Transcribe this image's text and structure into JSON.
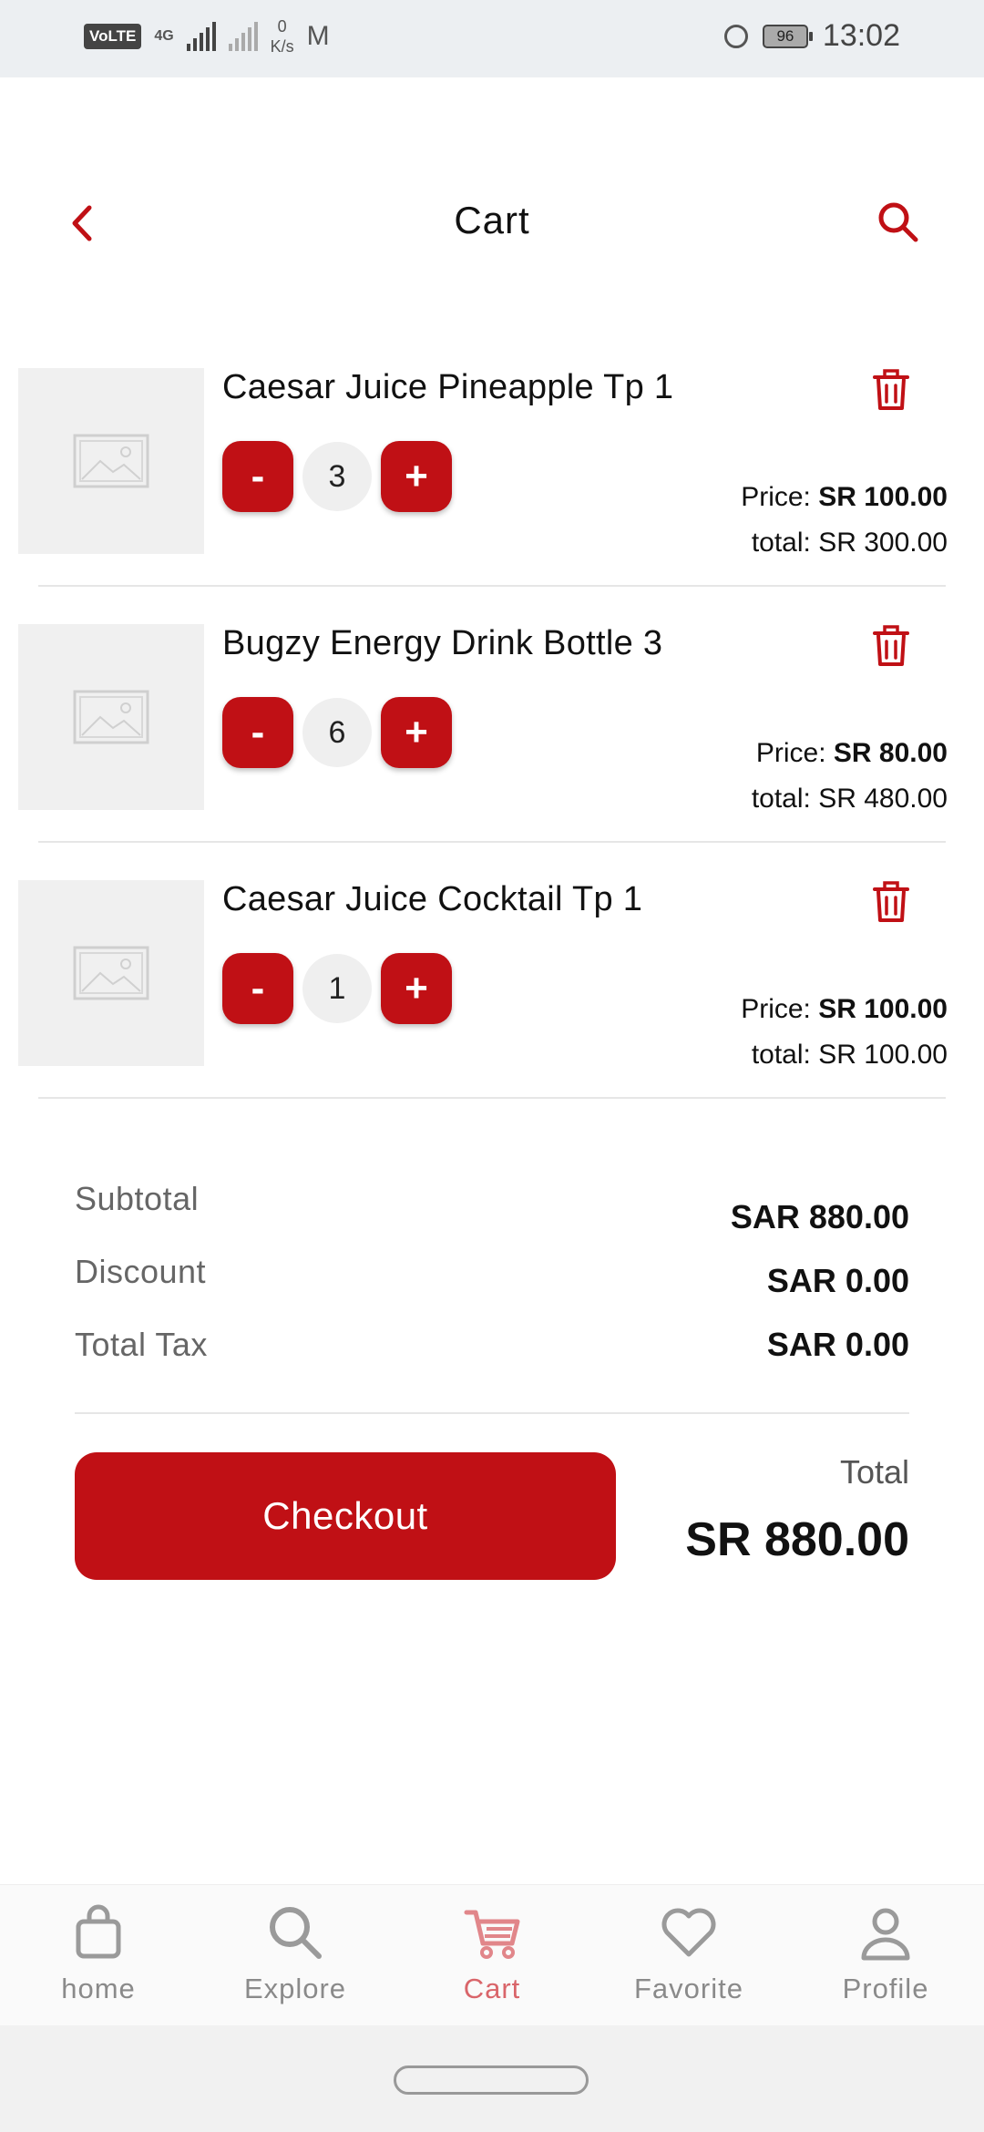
{
  "status_bar": {
    "volte": "VoLTE",
    "network_type": "4G",
    "speed_value": "0",
    "speed_unit": "K/s",
    "battery": "96",
    "time": "13:02"
  },
  "header": {
    "title": "Cart"
  },
  "items": [
    {
      "name": "Caesar Juice Pineapple Tp 1",
      "qty": "3",
      "price_label": "Price:",
      "price": "SR 100.00",
      "total_label": "total:",
      "total": "SR 300.00"
    },
    {
      "name": "Bugzy Energy Drink Bottle 3",
      "qty": "6",
      "price_label": "Price:",
      "price": "SR 80.00",
      "total_label": "total:",
      "total": "SR 480.00"
    },
    {
      "name": "Caesar Juice Cocktail Tp 1",
      "qty": "1",
      "price_label": "Price:",
      "price": "SR 100.00",
      "total_label": "total:",
      "total": "SR 100.00"
    }
  ],
  "qty_controls": {
    "minus": "-",
    "plus": "+"
  },
  "summary": {
    "subtotal_label": "Subtotal",
    "subtotal_value": "SAR 880.00",
    "discount_label": "Discount",
    "discount_value": "SAR 0.00",
    "tax_label": "Total Tax",
    "tax_value": "SAR 0.00"
  },
  "checkout": {
    "button_label": "Checkout",
    "total_label": "Total",
    "total_value": "SR 880.00"
  },
  "bottom_nav": [
    {
      "label": "home",
      "icon": "bag-icon"
    },
    {
      "label": "Explore",
      "icon": "search-icon"
    },
    {
      "label": "Cart",
      "icon": "cart-icon",
      "active": true
    },
    {
      "label": "Favorite",
      "icon": "heart-icon"
    },
    {
      "label": "Profile",
      "icon": "user-icon"
    }
  ],
  "colors": {
    "accent": "#c01015",
    "active_nav": "#d9656a",
    "muted": "#8a8a8a"
  }
}
